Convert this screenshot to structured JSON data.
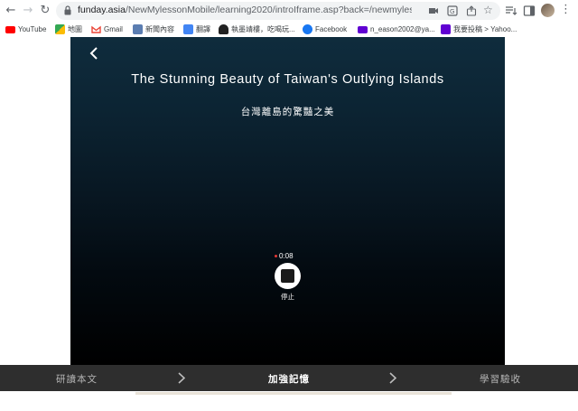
{
  "browser": {
    "url_host": "funday.asia",
    "url_path": "/NewMylessonMobile/learning2020/introIframe.asp?back=/newmylessonmobil...",
    "bookmarks": [
      {
        "label": "YouTube",
        "icon": "youtube-icon",
        "color": "#ff0000"
      },
      {
        "label": "地圖",
        "icon": "maps-icon",
        "color": "#34a853"
      },
      {
        "label": "Gmail",
        "icon": "gmail-icon",
        "color": "#ea4335"
      },
      {
        "label": "新聞內容",
        "icon": "news-icon",
        "color": "#5b7db1"
      },
      {
        "label": "翻譯",
        "icon": "translate-icon",
        "color": "#4285f4"
      },
      {
        "label": "執墨靖樓，吃喝玩...",
        "icon": "blog-icon",
        "color": "#222222"
      },
      {
        "label": "Facebook",
        "icon": "facebook-icon",
        "color": "#1877f2"
      },
      {
        "label": "n_eason2002@ya...",
        "icon": "mail-icon",
        "color": "#6001d2"
      },
      {
        "label": "我要投稿 > Yahoo...",
        "icon": "yahoo-icon",
        "color": "#6001d2"
      }
    ]
  },
  "lesson": {
    "title": "The Stunning Beauty of Taiwan's Outlying Islands",
    "subtitle": "台灣離島的驚豔之美",
    "timer": "0:08",
    "stop_label": "停止"
  },
  "steps": [
    {
      "label": "研讀本文",
      "active": false
    },
    {
      "label": "加強記憶",
      "active": true
    },
    {
      "label": "學習驗收",
      "active": false
    }
  ]
}
